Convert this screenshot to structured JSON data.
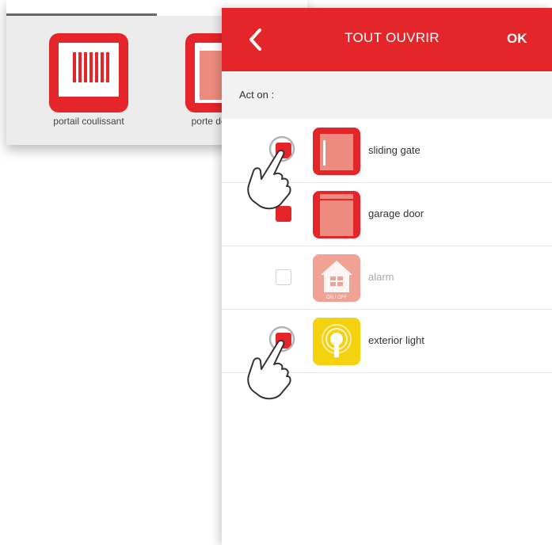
{
  "background": {
    "devices": [
      {
        "label": "portail coulissant",
        "icon": "sliding-gate-icon"
      },
      {
        "label": "porte de garage",
        "icon": "garage-door-icon"
      }
    ]
  },
  "header": {
    "back_icon": "chevron-left-icon",
    "title": "TOUT OUVRIR",
    "ok_label": "OK"
  },
  "act_on_label": "Act on :",
  "devices": [
    {
      "label": "sliding gate",
      "checked": true,
      "icon": "sliding-gate-icon"
    },
    {
      "label": "garage door",
      "checked": true,
      "icon": "garage-door-icon"
    },
    {
      "label": "alarm",
      "checked": false,
      "icon": "alarm-house-icon",
      "badge": "ON / OFF"
    },
    {
      "label": "exterior light",
      "checked": true,
      "icon": "light-bulb-icon"
    }
  ],
  "colors": {
    "brand_red": "#e4262b",
    "faded_red": "#ee8b80",
    "light_yellow": "#f4d20f"
  }
}
